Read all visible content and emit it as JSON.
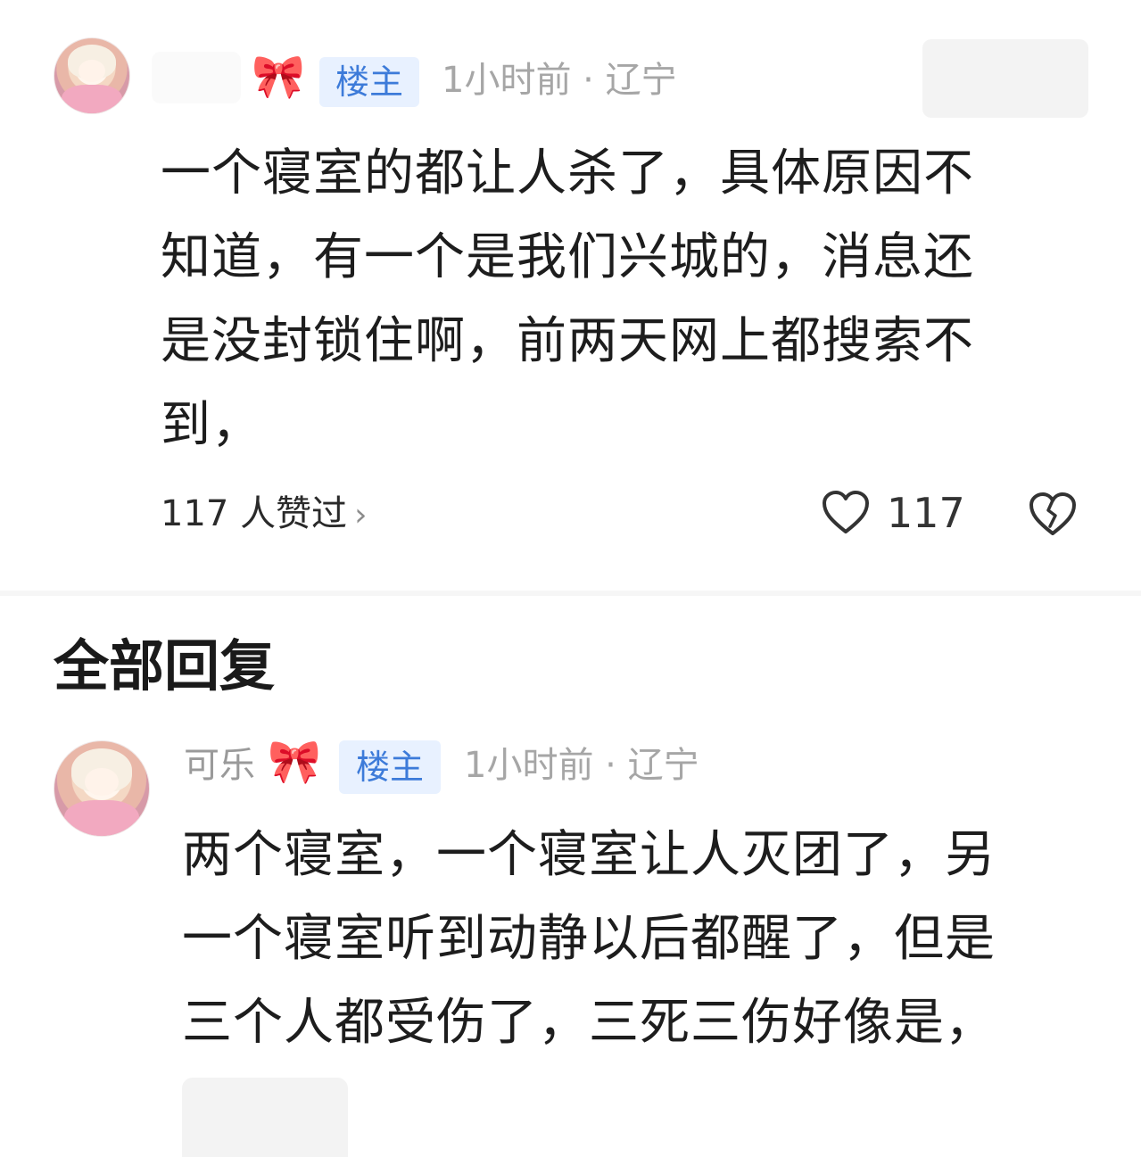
{
  "post": {
    "bow_icon": "pink-bow-icon",
    "badge": "楼主",
    "meta": "1小时前 · 辽宁",
    "text": "一个寝室的都让人杀了，具体原因不知道，有一个是我们兴城的，消息还是没封锁住啊，前两天网上都搜索不到，",
    "lines": [
      "一个寝室的都让人杀了，具体原因不",
      "知道，有一个是我们兴城的，消息还",
      "是没封锁住啊，前两天网上都搜索不",
      "到，"
    ],
    "likes_summary": "117 人赞过",
    "likes_chevron": "›",
    "like_count": "117"
  },
  "replies_section": {
    "title": "全部回复"
  },
  "reply": {
    "nickname": "可乐",
    "bow_icon": "pink-bow-icon",
    "badge": "楼主",
    "meta": "1小时前 · 辽宁",
    "lines": [
      "两个寝室，一个寝室让人灭团了，另",
      "一个寝室听到动静以后都醒了，但是",
      "三个人都受伤了，三死三伤好像是，"
    ]
  },
  "colors": {
    "badge_bg": "#e8f1ff",
    "badge_text": "#3d7bd9",
    "meta_text": "#a6a6a6",
    "bow": "#f07fa8"
  }
}
